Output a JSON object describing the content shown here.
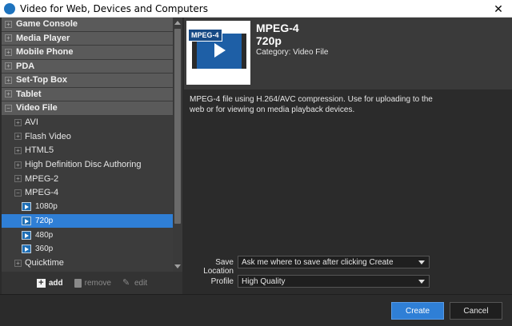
{
  "window": {
    "title": "Video for Web, Devices and Computers",
    "close_glyph": "✕"
  },
  "tree": {
    "categories": [
      {
        "label": "Game Console",
        "expander": "+"
      },
      {
        "label": "Media Player",
        "expander": "+"
      },
      {
        "label": "Mobile Phone",
        "expander": "+"
      },
      {
        "label": "PDA",
        "expander": "+"
      },
      {
        "label": "Set-Top Box",
        "expander": "+"
      },
      {
        "label": "Tablet",
        "expander": "+"
      },
      {
        "label": "Video File",
        "expander": "−"
      }
    ],
    "formats": [
      {
        "label": "AVI",
        "expander": "+"
      },
      {
        "label": "Flash Video",
        "expander": "+"
      },
      {
        "label": "HTML5",
        "expander": "+"
      },
      {
        "label": "High Definition Disc Authoring",
        "expander": "+"
      },
      {
        "label": "MPEG-2",
        "expander": "+"
      },
      {
        "label": "MPEG-4",
        "expander": "−"
      }
    ],
    "presets": [
      {
        "label": "1080p"
      },
      {
        "label": "720p"
      },
      {
        "label": "480p"
      },
      {
        "label": "360p"
      }
    ],
    "trailing_format": {
      "label": "Quicktime",
      "expander": "+"
    }
  },
  "toolbar": {
    "add": "add",
    "remove": "remove",
    "edit": "edit",
    "add_glyph": "+",
    "edit_glyph": "✎"
  },
  "preset": {
    "badge": "MPEG-4",
    "title": "MPEG-4",
    "subtitle": "720p",
    "category": "Category: Video File",
    "description": "MPEG-4 file using H.264/AVC compression. Use for uploading to the web or for viewing on media playback devices."
  },
  "fields": {
    "save_location_label": "Save Location",
    "save_location_value": "Ask me where to save after clicking Create",
    "profile_label": "Profile",
    "profile_value": "High Quality"
  },
  "buttons": {
    "create": "Create",
    "cancel": "Cancel"
  },
  "colors": {
    "accent": "#2f7fd6",
    "panel": "#3c3c3c",
    "header_row": "#5a5a5a"
  }
}
